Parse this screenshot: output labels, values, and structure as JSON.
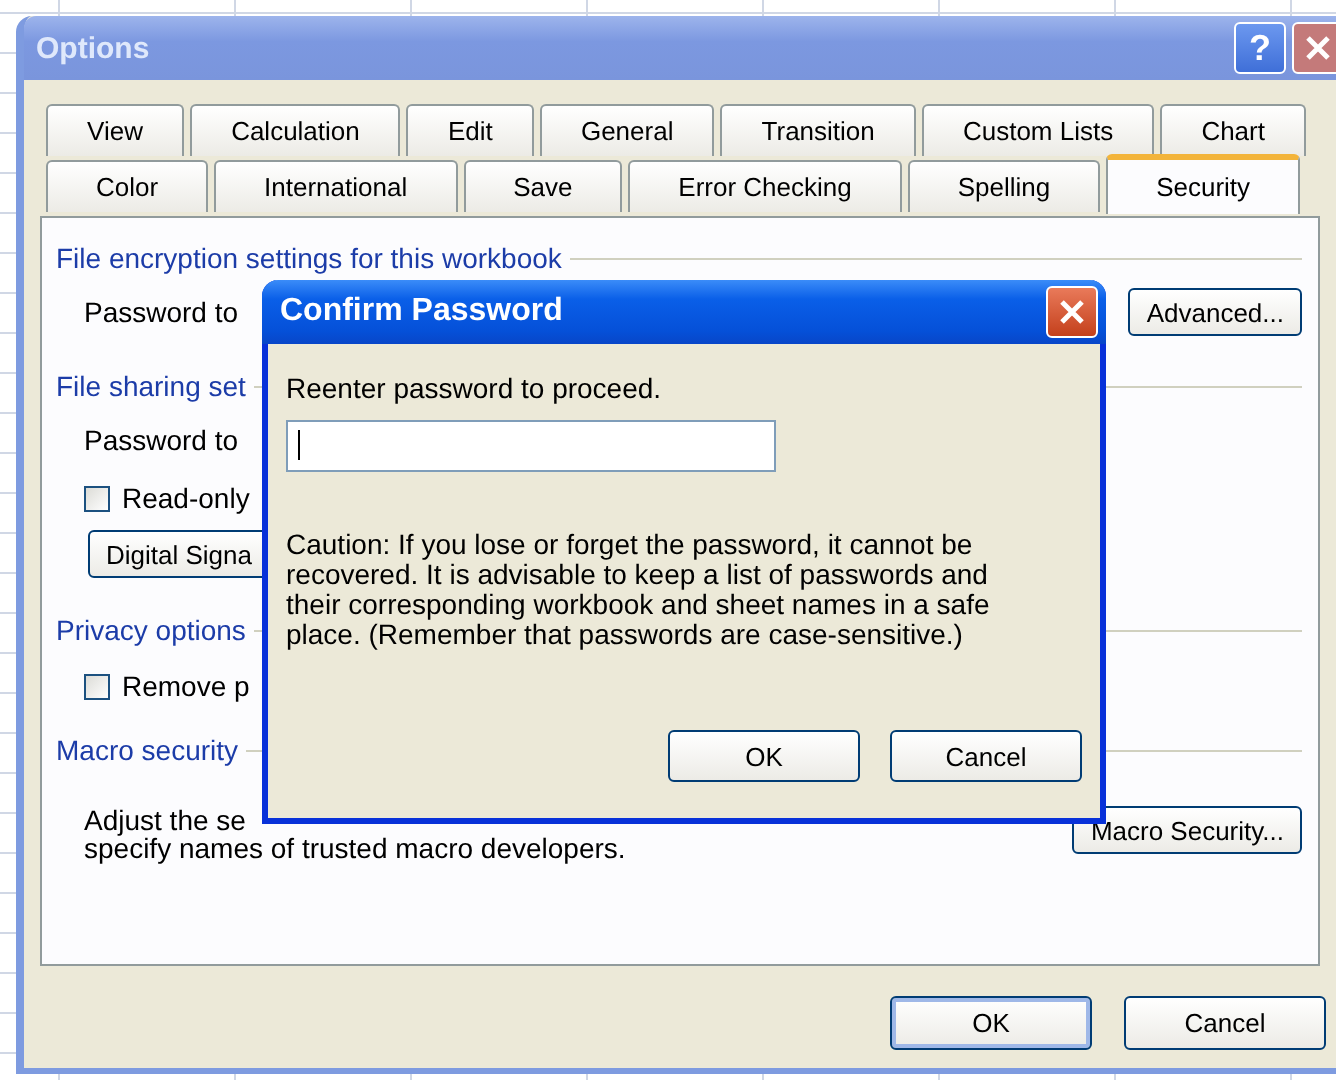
{
  "window": {
    "title": "Options",
    "help_button": "?"
  },
  "tab_rows": [
    [
      {
        "label": "View",
        "selected": false
      },
      {
        "label": "Calculation",
        "selected": false
      },
      {
        "label": "Edit",
        "selected": false
      },
      {
        "label": "General",
        "selected": false
      },
      {
        "label": "Transition",
        "selected": false
      },
      {
        "label": "Custom Lists",
        "selected": false
      },
      {
        "label": "Chart",
        "selected": false
      }
    ],
    [
      {
        "label": "Color",
        "selected": false
      },
      {
        "label": "International",
        "selected": false
      },
      {
        "label": "Save",
        "selected": false
      },
      {
        "label": "Error Checking",
        "selected": false
      },
      {
        "label": "Spelling",
        "selected": false
      },
      {
        "label": "Security",
        "selected": true
      }
    ]
  ],
  "security_page": {
    "encryption_heading": "File encryption settings for this workbook",
    "open_password_label": "Password to",
    "advanced_button": "Advanced...",
    "sharing_heading": "File sharing set",
    "modify_password_label": "Password to",
    "read_only": {
      "label": "Read-only",
      "checked": false
    },
    "digital_signatures_button": "Digital Signa",
    "privacy_heading": "Privacy options",
    "remove_info": {
      "label": "Remove p",
      "checked": false
    },
    "macro_heading": "Macro security",
    "macro_text_lines": [
      "Adjust the se",
      "specify names of trusted macro developers."
    ],
    "macro_security_button": "Macro Security..."
  },
  "buttons": [
    "OK",
    "Cancel"
  ],
  "dialog": {
    "title": "Confirm Password",
    "prompt": "Reenter password to proceed.",
    "caution_lines": [
      "Caution: If you lose or forget the password, it cannot be",
      "recovered. It is advisable to keep a list of passwords and",
      "their corresponding workbook and sheet names in a safe",
      "place.  (Remember that passwords are case-sensitive.)"
    ],
    "buttons": [
      "OK",
      "Cancel"
    ]
  }
}
